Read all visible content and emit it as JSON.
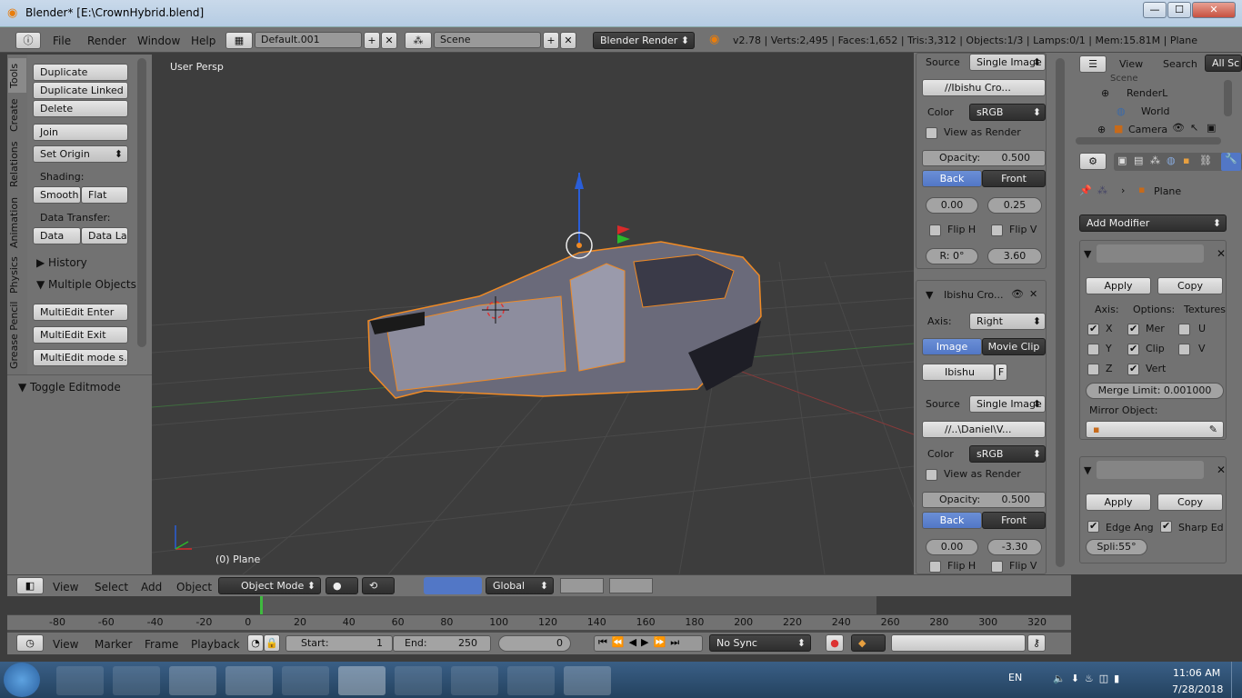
{
  "window": {
    "title": "Blender* [E:\\CrownHybrid.blend]",
    "min": "—",
    "max": "☐",
    "close": "✕"
  },
  "infobar": {
    "menus": [
      "File",
      "Render",
      "Window",
      "Help"
    ],
    "layout": "Default.001",
    "scene": "Scene",
    "engine": "Blender Render",
    "stats": "v2.78 | Verts:2,495 | Faces:1,652 | Tris:3,312 | Objects:1/3 | Lamps:0/1 | Mem:15.81M | Plane"
  },
  "tabs": [
    "Tools",
    "Create",
    "Relations",
    "Animation",
    "Physics",
    "Grease Pencil"
  ],
  "tools": {
    "duplicate": "Duplicate",
    "duplicate_linked": "Duplicate Linked",
    "delete": "Delete",
    "join": "Join",
    "set_origin": "Set Origin",
    "shading": "Shading:",
    "smooth": "Smooth",
    "flat": "Flat",
    "data_transfer": "Data Transfer:",
    "data": "Data",
    "data_la": "Data La",
    "history": "History",
    "multiple_objects": "Multiple Objects",
    "me_enter": "MultiEdit Enter",
    "me_exit": "MultiEdit Exit",
    "me_mode": "MultiEdit mode s...",
    "toggle_editmode": "Toggle Editmode"
  },
  "viewport": {
    "view_name": "User Persp",
    "object_label": "(0) Plane"
  },
  "imgpanel": {
    "source_label": "Source",
    "source": "Single Image",
    "file1": "//Ibishu Cro...",
    "color_label": "Color",
    "color": "sRGB",
    "view_as_render": "View as Render",
    "opacity_label": "Opacity:",
    "opacity": "0.500",
    "back": "Back",
    "front": "Front",
    "x1": "0.00",
    "y1": "0.25",
    "flip_h": "Flip H",
    "flip_v": "Flip V",
    "rot": "R: 0°",
    "size": "3.60",
    "img2_name": "Ibishu Cro...",
    "axis_label": "Axis:",
    "axis": "Right",
    "image": "Image",
    "movie_clip": "Movie Clip",
    "img2_field": "Ibishu",
    "img2_f": "F",
    "file2": "//..\\Daniel\\V...",
    "x2": "0.00",
    "y2": "-3.30"
  },
  "outliner": {
    "view": "View",
    "search": "Search",
    "all": "All Sc",
    "scene": "Scene",
    "renderlayers": "RenderL",
    "world": "World",
    "camera": "Camera"
  },
  "props": {
    "object": "Plane",
    "add_modifier": "Add Modifier",
    "apply": "Apply",
    "copy": "Copy",
    "axis": "Axis:",
    "options": "Options:",
    "textures": "Textures",
    "x": "X",
    "y": "Y",
    "z": "Z",
    "merge": "Mer",
    "clip": "Clip",
    "vert": "Vert",
    "u": "U",
    "v": "V",
    "merge_limit": "Merge Limit:  0.001000",
    "mirror_object": "Mirror Object:",
    "edge_ang": "Edge Ang",
    "sharp_ed": "Sharp Ed",
    "split": "Spli:55°"
  },
  "vpheader": {
    "view": "View",
    "select": "Select",
    "add": "Add",
    "object": "Object",
    "mode": "Object Mode",
    "orientation": "Global"
  },
  "timeline": {
    "ticks": [
      "-80",
      "-60",
      "-40",
      "-20",
      "0",
      "20",
      "40",
      "60",
      "80",
      "100",
      "120",
      "140",
      "160",
      "180",
      "200",
      "220",
      "240",
      "260",
      "280",
      "300",
      "320"
    ]
  },
  "tlheader": {
    "view": "View",
    "marker": "Marker",
    "frame": "Frame",
    "playback": "Playback",
    "start": "Start:",
    "start_val": "1",
    "end": "End:",
    "end_val": "250",
    "current": "0",
    "sync": "No Sync"
  },
  "taskbar": {
    "lang": "EN",
    "time": "11:06 AM",
    "date": "7/28/2018"
  }
}
